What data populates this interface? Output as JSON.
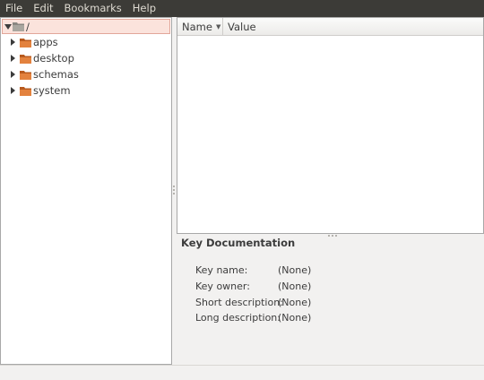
{
  "menubar": {
    "items": [
      "File",
      "Edit",
      "Bookmarks",
      "Help"
    ]
  },
  "tree": {
    "root": {
      "label": "/"
    },
    "children": [
      {
        "label": "apps"
      },
      {
        "label": "desktop"
      },
      {
        "label": "schemas"
      },
      {
        "label": "system"
      }
    ]
  },
  "list": {
    "columns": {
      "name": "Name",
      "value": "Value"
    },
    "sort_icon": "sort-descending-icon"
  },
  "doc": {
    "title": "Key Documentation",
    "rows": [
      {
        "key": "Key name:",
        "value": "(None)"
      },
      {
        "key": "Key owner:",
        "value": "(None)"
      },
      {
        "key": "Short description:",
        "value": "(None)"
      },
      {
        "key": "Long description:",
        "value": "(None)"
      }
    ]
  },
  "colors": {
    "menubar_bg": "#3c3b37",
    "selection_bg": "#fbe3dc",
    "folder": "#e3823e"
  }
}
